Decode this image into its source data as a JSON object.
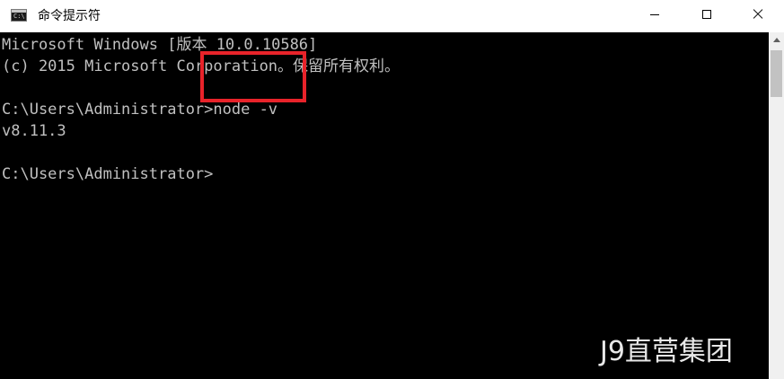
{
  "window": {
    "title": "命令提示符",
    "icon": "cmd-icon",
    "icon_glyph": "C:\\"
  },
  "controls": {
    "minimize_icon": "minimize-icon",
    "maximize_icon": "maximize-icon",
    "close_icon": "close-icon"
  },
  "console": {
    "lines": [
      "Microsoft Windows [版本 10.0.10586]",
      "(c) 2015 Microsoft Corporation。保留所有权利。",
      "",
      "C:\\Users\\Administrator>node -v",
      "v8.11.3",
      "",
      "C:\\Users\\Administrator>"
    ]
  },
  "annotation": {
    "highlight_color": "#e8232a"
  },
  "watermark": {
    "text": "J9直营集团"
  },
  "colors": {
    "console_bg": "#000000",
    "console_fg": "#c0c0c0",
    "titlebar_bg": "#ffffff"
  }
}
